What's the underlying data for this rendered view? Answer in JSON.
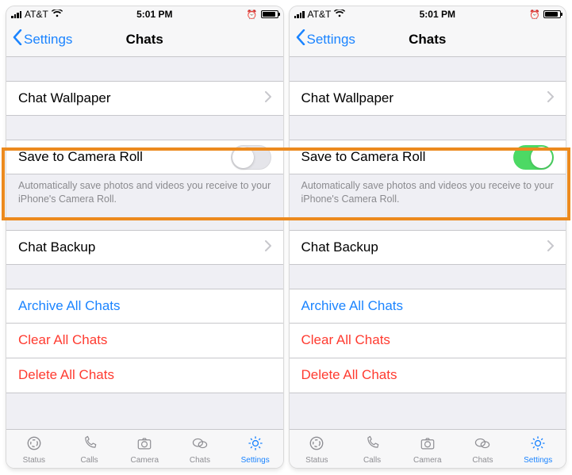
{
  "statusbar": {
    "carrier": "AT&T",
    "time": "5:01 PM"
  },
  "navbar": {
    "back_label": "Settings",
    "title": "Chats"
  },
  "rows": {
    "wallpaper": "Chat Wallpaper",
    "save_roll": "Save to Camera Roll",
    "save_roll_footer": "Automatically save photos and videos you receive to your iPhone's Camera Roll.",
    "backup": "Chat Backup",
    "archive": "Archive All Chats",
    "clear": "Clear All Chats",
    "delete": "Delete All Chats"
  },
  "tabs": {
    "status": "Status",
    "calls": "Calls",
    "camera": "Camera",
    "chats": "Chats",
    "settings": "Settings"
  },
  "toggle_left": "off",
  "toggle_right": "on",
  "colors": {
    "ios_blue": "#1b84ff",
    "ios_red": "#ff3b30",
    "ios_green": "#4cd964",
    "highlight": "#ec8a1e"
  }
}
